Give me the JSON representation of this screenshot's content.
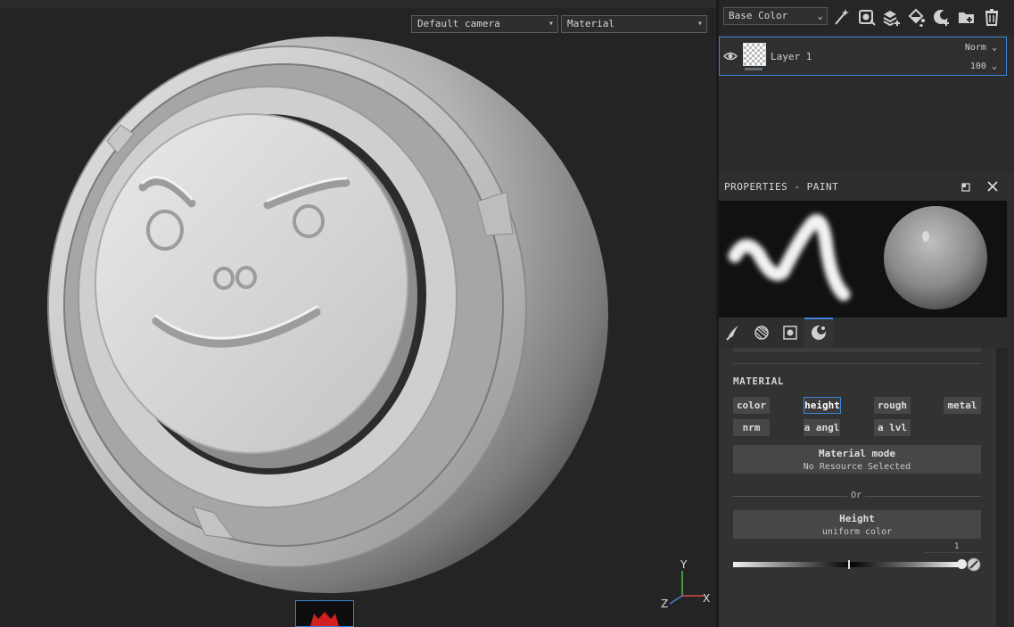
{
  "viewport": {
    "camera_select": "Default camera",
    "shading_select": "Material",
    "axes": {
      "x": "X",
      "y": "Y",
      "z": "Z"
    }
  },
  "layers": {
    "channel_select": "Base Color",
    "toolbar_icons": [
      "magic-wand-icon",
      "add-effect-icon",
      "add-layer-icon",
      "fill-layer-icon",
      "mask-icon",
      "folder-add-icon",
      "trash-icon"
    ],
    "items": [
      {
        "name": "Layer 1",
        "blend": "Norm",
        "opacity": "100"
      }
    ]
  },
  "properties": {
    "title": "PROPERTIES - PAINT",
    "tabs": [
      "brush-icon",
      "alpha-icon",
      "stencil-icon",
      "material-icon"
    ],
    "material": {
      "section_title": "MATERIAL",
      "channels": [
        "color",
        "height",
        "rough",
        "metal",
        "nrm",
        "a angl",
        "a lvl"
      ],
      "active_channel": "height",
      "material_mode_title": "Material mode",
      "material_mode_value": "No Resource Selected",
      "or_label": "Or",
      "height_title": "Height",
      "height_value": "uniform color",
      "slider_value": "1"
    }
  },
  "colors": {
    "accent": "#3f84d8",
    "panel_bg": "#2b2b2b",
    "viewport_bg": "#242424"
  }
}
